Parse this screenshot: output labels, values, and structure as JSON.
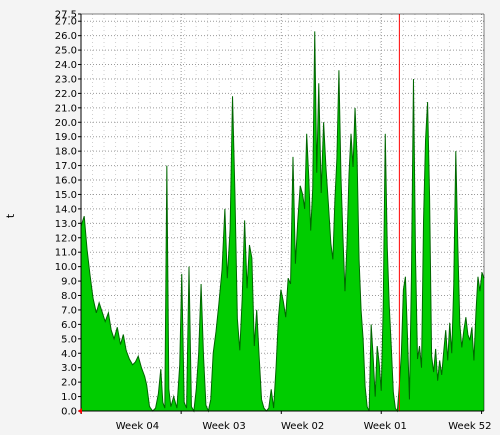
{
  "chart_data": {
    "type": "area",
    "title": "",
    "xlabel": "",
    "ylabel": "t",
    "ylim": [
      0,
      27.5
    ],
    "y_ticks": [
      "0.0",
      "1.0",
      "2.0",
      "3.0",
      "4.0",
      "5.0",
      "6.0",
      "7.0",
      "8.0",
      "9.0",
      "10.0",
      "11.0",
      "12.0",
      "13.0",
      "14.0",
      "15.0",
      "16.0",
      "17.0",
      "18.0",
      "19.0",
      "20.0",
      "21.0",
      "22.0",
      "23.0",
      "24.0",
      "25.0",
      "26.0",
      "27.0",
      "27.5"
    ],
    "x_ticks": [
      "Week 04",
      "Week 03",
      "Week 02",
      "Week 01",
      "Week 52"
    ],
    "grid": true,
    "colors": {
      "area": "#00cc00",
      "line": "#006600",
      "marker": "#ff0000",
      "background": "#f4f4f4",
      "plot": "#ffffff"
    },
    "marker_position": 0.79,
    "series": [
      {
        "values": [
          [
            0.0,
            12.8
          ],
          [
            0.008,
            13.5
          ],
          [
            0.015,
            11.2
          ],
          [
            0.022,
            9.5
          ],
          [
            0.03,
            7.8
          ],
          [
            0.038,
            6.8
          ],
          [
            0.045,
            7.5
          ],
          [
            0.052,
            6.9
          ],
          [
            0.06,
            6.2
          ],
          [
            0.068,
            6.8
          ],
          [
            0.075,
            5.6
          ],
          [
            0.082,
            5.0
          ],
          [
            0.09,
            5.8
          ],
          [
            0.098,
            4.6
          ],
          [
            0.105,
            5.3
          ],
          [
            0.112,
            4.2
          ],
          [
            0.12,
            3.6
          ],
          [
            0.128,
            3.2
          ],
          [
            0.135,
            3.4
          ],
          [
            0.142,
            3.8
          ],
          [
            0.15,
            3.0
          ],
          [
            0.158,
            2.4
          ],
          [
            0.163,
            1.8
          ],
          [
            0.17,
            0.3
          ],
          [
            0.178,
            0.0
          ],
          [
            0.185,
            0.2
          ],
          [
            0.192,
            1.2
          ],
          [
            0.198,
            2.9
          ],
          [
            0.203,
            0.6
          ],
          [
            0.208,
            0.2
          ],
          [
            0.213,
            17.0
          ],
          [
            0.218,
            1.5
          ],
          [
            0.223,
            0.3
          ],
          [
            0.23,
            1.0
          ],
          [
            0.238,
            0.2
          ],
          [
            0.245,
            3.2
          ],
          [
            0.25,
            9.5
          ],
          [
            0.256,
            0.6
          ],
          [
            0.262,
            0.2
          ],
          [
            0.268,
            10.0
          ],
          [
            0.274,
            0.3
          ],
          [
            0.28,
            0.0
          ],
          [
            0.286,
            1.5
          ],
          [
            0.292,
            4.0
          ],
          [
            0.298,
            8.8
          ],
          [
            0.304,
            3.8
          ],
          [
            0.31,
            0.4
          ],
          [
            0.316,
            0.0
          ],
          [
            0.322,
            0.8
          ],
          [
            0.328,
            4.0
          ],
          [
            0.335,
            5.5
          ],
          [
            0.342,
            7.4
          ],
          [
            0.35,
            9.8
          ],
          [
            0.357,
            14.0
          ],
          [
            0.363,
            9.2
          ],
          [
            0.37,
            12.6
          ],
          [
            0.376,
            21.8
          ],
          [
            0.382,
            15.0
          ],
          [
            0.388,
            6.4
          ],
          [
            0.394,
            4.2
          ],
          [
            0.4,
            7.8
          ],
          [
            0.406,
            13.2
          ],
          [
            0.412,
            8.5
          ],
          [
            0.418,
            11.5
          ],
          [
            0.424,
            10.6
          ],
          [
            0.43,
            4.5
          ],
          [
            0.436,
            7.0
          ],
          [
            0.442,
            3.8
          ],
          [
            0.448,
            0.8
          ],
          [
            0.454,
            0.2
          ],
          [
            0.46,
            0.0
          ],
          [
            0.466,
            0.2
          ],
          [
            0.472,
            1.5
          ],
          [
            0.478,
            0.2
          ],
          [
            0.484,
            3.0
          ],
          [
            0.49,
            6.5
          ],
          [
            0.496,
            8.4
          ],
          [
            0.502,
            7.6
          ],
          [
            0.508,
            6.5
          ],
          [
            0.514,
            9.2
          ],
          [
            0.52,
            8.8
          ],
          [
            0.526,
            17.6
          ],
          [
            0.532,
            10.2
          ],
          [
            0.538,
            13.2
          ],
          [
            0.544,
            15.6
          ],
          [
            0.55,
            15.0
          ],
          [
            0.555,
            14.0
          ],
          [
            0.56,
            19.2
          ],
          [
            0.565,
            16.3
          ],
          [
            0.57,
            12.5
          ],
          [
            0.575,
            15.4
          ],
          [
            0.58,
            26.3
          ],
          [
            0.585,
            16.5
          ],
          [
            0.59,
            22.7
          ],
          [
            0.596,
            15.1
          ],
          [
            0.602,
            20.0
          ],
          [
            0.608,
            16.8
          ],
          [
            0.614,
            14.3
          ],
          [
            0.62,
            11.6
          ],
          [
            0.625,
            10.5
          ],
          [
            0.63,
            14.6
          ],
          [
            0.635,
            17.5
          ],
          [
            0.64,
            23.6
          ],
          [
            0.645,
            16.3
          ],
          [
            0.65,
            12.0
          ],
          [
            0.655,
            8.3
          ],
          [
            0.66,
            11.5
          ],
          [
            0.665,
            16.4
          ],
          [
            0.67,
            19.2
          ],
          [
            0.675,
            16.9
          ],
          [
            0.68,
            21.0
          ],
          [
            0.685,
            17.6
          ],
          [
            0.69,
            10.5
          ],
          [
            0.695,
            7.0
          ],
          [
            0.7,
            5.0
          ],
          [
            0.705,
            1.7
          ],
          [
            0.71,
            0.3
          ],
          [
            0.715,
            0.0
          ],
          [
            0.72,
            6.0
          ],
          [
            0.725,
            3.7
          ],
          [
            0.73,
            1.0
          ],
          [
            0.735,
            4.5
          ],
          [
            0.74,
            3.3
          ],
          [
            0.745,
            1.4
          ],
          [
            0.75,
            7.3
          ],
          [
            0.755,
            19.2
          ],
          [
            0.76,
            11.3
          ],
          [
            0.765,
            7.2
          ],
          [
            0.77,
            4.4
          ],
          [
            0.775,
            1.3
          ],
          [
            0.78,
            0.2
          ],
          [
            0.785,
            0.0
          ],
          [
            0.79,
            1.8
          ],
          [
            0.795,
            4.0
          ],
          [
            0.8,
            8.4
          ],
          [
            0.805,
            9.3
          ],
          [
            0.81,
            5.3
          ],
          [
            0.815,
            0.8
          ],
          [
            0.82,
            9.4
          ],
          [
            0.825,
            23.0
          ],
          [
            0.83,
            10.8
          ],
          [
            0.835,
            3.6
          ],
          [
            0.84,
            4.5
          ],
          [
            0.845,
            3.0
          ],
          [
            0.85,
            13.2
          ],
          [
            0.855,
            18.8
          ],
          [
            0.86,
            21.4
          ],
          [
            0.865,
            14.8
          ],
          [
            0.87,
            3.8
          ],
          [
            0.875,
            2.7
          ],
          [
            0.88,
            4.3
          ],
          [
            0.885,
            2.1
          ],
          [
            0.89,
            3.5
          ],
          [
            0.895,
            2.5
          ],
          [
            0.9,
            4.1
          ],
          [
            0.905,
            5.6
          ],
          [
            0.91,
            3.5
          ],
          [
            0.915,
            6.1
          ],
          [
            0.92,
            4.0
          ],
          [
            0.925,
            8.8
          ],
          [
            0.93,
            18.0
          ],
          [
            0.935,
            11.5
          ],
          [
            0.94,
            6.0
          ],
          [
            0.945,
            4.4
          ],
          [
            0.95,
            5.6
          ],
          [
            0.955,
            6.5
          ],
          [
            0.96,
            5.3
          ],
          [
            0.965,
            4.9
          ],
          [
            0.97,
            5.8
          ],
          [
            0.975,
            3.5
          ],
          [
            0.98,
            6.8
          ],
          [
            0.985,
            9.3
          ],
          [
            0.99,
            8.3
          ],
          [
            0.995,
            9.6
          ],
          [
            1.0,
            9.2
          ]
        ]
      }
    ]
  }
}
